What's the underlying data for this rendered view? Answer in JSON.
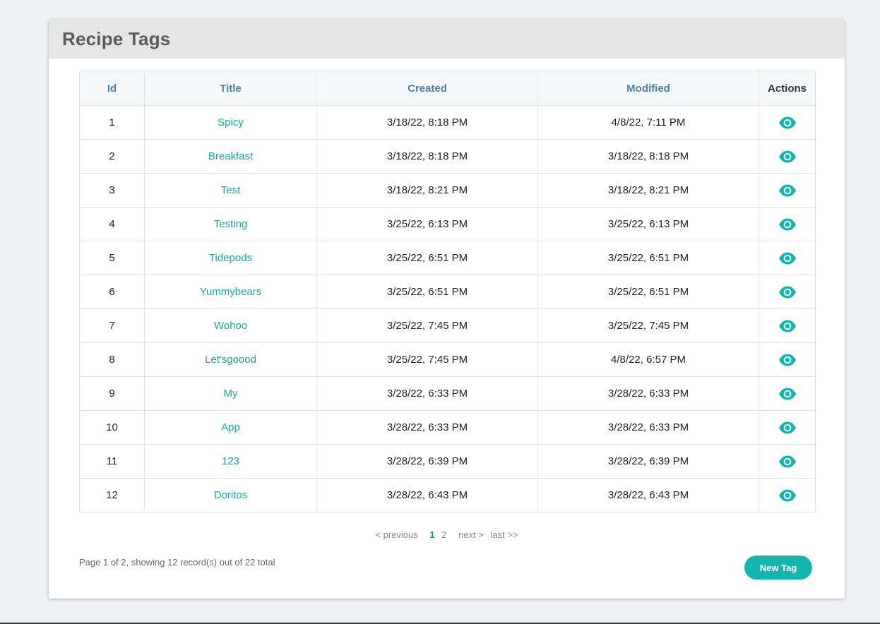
{
  "page": {
    "title": "Recipe Tags"
  },
  "table": {
    "headers": {
      "id": "Id",
      "title": "Title",
      "created": "Created",
      "modified": "Modified",
      "actions": "Actions"
    },
    "rows": [
      {
        "id": "1",
        "title": "Spicy",
        "created": "3/18/22, 8:18 PM",
        "modified": "4/8/22, 7:11 PM"
      },
      {
        "id": "2",
        "title": "Breakfast",
        "created": "3/18/22, 8:18 PM",
        "modified": "3/18/22, 8:18 PM"
      },
      {
        "id": "3",
        "title": "Test",
        "created": "3/18/22, 8:21 PM",
        "modified": "3/18/22, 8:21 PM"
      },
      {
        "id": "4",
        "title": "Testing",
        "created": "3/25/22, 6:13 PM",
        "modified": "3/25/22, 6:13 PM"
      },
      {
        "id": "5",
        "title": "Tidepods",
        "created": "3/25/22, 6:51 PM",
        "modified": "3/25/22, 6:51 PM"
      },
      {
        "id": "6",
        "title": "Yummybears",
        "created": "3/25/22, 6:51 PM",
        "modified": "3/25/22, 6:51 PM"
      },
      {
        "id": "7",
        "title": "Wohoo",
        "created": "3/25/22, 7:45 PM",
        "modified": "3/25/22, 7:45 PM"
      },
      {
        "id": "8",
        "title": "Let'sgoood",
        "created": "3/25/22, 7:45 PM",
        "modified": "4/8/22, 6:57 PM"
      },
      {
        "id": "9",
        "title": "My",
        "created": "3/28/22, 6:33 PM",
        "modified": "3/28/22, 6:33 PM"
      },
      {
        "id": "10",
        "title": "App",
        "created": "3/28/22, 6:33 PM",
        "modified": "3/28/22, 6:33 PM"
      },
      {
        "id": "11",
        "title": "123",
        "created": "3/28/22, 6:39 PM",
        "modified": "3/28/22, 6:39 PM"
      },
      {
        "id": "12",
        "title": "Doritos",
        "created": "3/28/22, 6:43 PM",
        "modified": "3/28/22, 6:43 PM"
      }
    ],
    "action_icon": "eye-icon"
  },
  "pagination": {
    "previous": "< previous",
    "page1": "1",
    "page2": "2",
    "next": "next >",
    "last": "last >>"
  },
  "summary": "Page 1 of 2, showing 12 record(s) out of 22 total",
  "buttons": {
    "new_tag": "New Tag"
  },
  "colors": {
    "accent": "#13b5ae",
    "link": "#1aa5a0",
    "header_link": "#4a7fb6"
  }
}
